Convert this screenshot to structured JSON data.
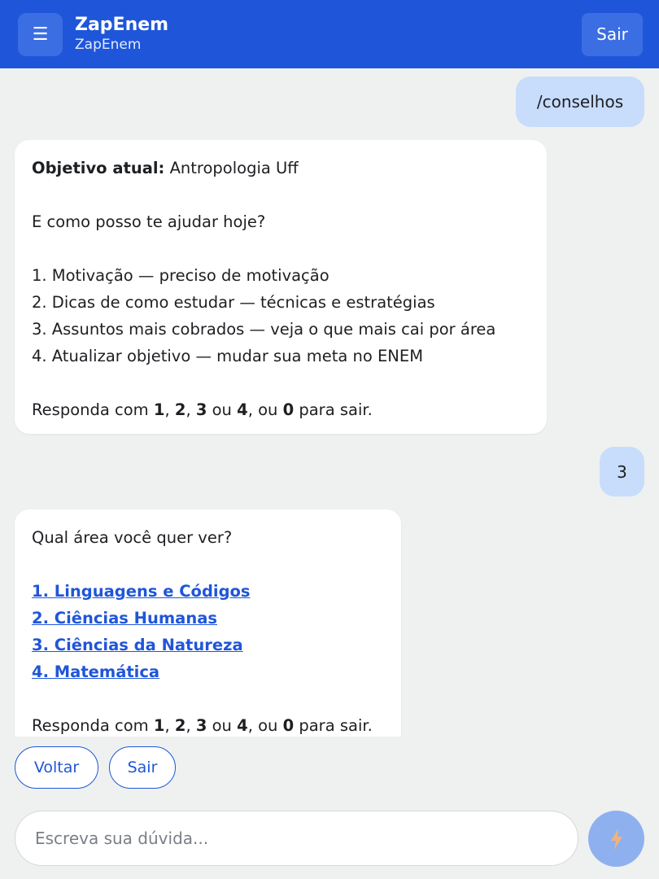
{
  "header": {
    "menu_icon": "☰",
    "title": "ZapEnem",
    "subtitle": "ZapEnem",
    "logout_label": "Sair"
  },
  "messages": {
    "user1": "/conselhos",
    "bot1": {
      "goal_label": "Objetivo atual:",
      "goal_value": "Antropologia Uff",
      "prompt": "E como posso te ajudar hoje?",
      "options": [
        "1. Motivação — preciso de motivação",
        "2. Dicas de como estudar — técnicas e estratégias",
        "3. Assuntos mais cobrados — veja o que mais cai por área",
        "4. Atualizar objetivo — mudar sua meta no ENEM"
      ],
      "reply_prefix": "Responda com ",
      "reply_n1": "1",
      "reply_sep1": ", ",
      "reply_n2": "2",
      "reply_sep2": ", ",
      "reply_n3": "3",
      "reply_mid": " ou ",
      "reply_n4": "4",
      "reply_or": ", ou ",
      "reply_n0": "0",
      "reply_suffix": " para sair."
    },
    "user2": "3",
    "bot2": {
      "prompt": "Qual área você quer ver?",
      "links": [
        "1. Linguagens e Códigos",
        "2. Ciências Humanas",
        "3. Ciências da Natureza",
        "4. Matemática"
      ],
      "reply_prefix": "Responda com ",
      "reply_n1": "1",
      "reply_sep1": ", ",
      "reply_n2": "2",
      "reply_sep2": ", ",
      "reply_n3": "3",
      "reply_mid": " ou ",
      "reply_n4": "4",
      "reply_or": ", ou ",
      "reply_n0": "0",
      "reply_suffix": " para sair."
    }
  },
  "quick_replies": {
    "back_label": "Voltar",
    "exit_label": "Sair"
  },
  "composer": {
    "placeholder": "Escreva sua dúvida...",
    "send_icon": "lightning-bolt-icon"
  },
  "colors": {
    "brand": "#1f56d9",
    "user_bubble": "#c8dcfc",
    "send_button": "#8fb0ef",
    "send_icon": "#f2b27a"
  }
}
